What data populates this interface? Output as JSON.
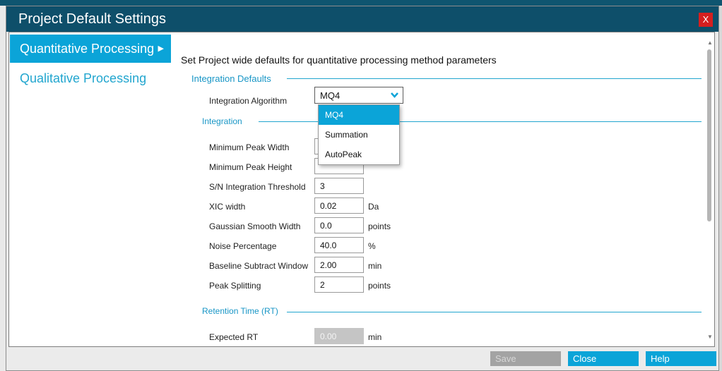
{
  "window": {
    "title": "Project Default Settings",
    "close_label": "X"
  },
  "nav": {
    "items": [
      {
        "label": "Quantitative Processing"
      },
      {
        "label": "Qualitative Processing"
      }
    ]
  },
  "main": {
    "heading": "Set Project wide defaults for quantitative processing method parameters",
    "integration_defaults": {
      "title": "Integration Defaults",
      "algorithm_label": "Integration Algorithm",
      "algorithm_value": "MQ4",
      "options": [
        "MQ4",
        "Summation",
        "AutoPeak"
      ]
    },
    "integration": {
      "title": "Integration",
      "fields": [
        {
          "label": "Minimum Peak Width",
          "value": "",
          "unit": ""
        },
        {
          "label": "Minimum Peak Height",
          "value": "",
          "unit": ""
        },
        {
          "label": "S/N Integration Threshold",
          "value": "3",
          "unit": ""
        },
        {
          "label": "XIC width",
          "value": "0.02",
          "unit": "Da"
        },
        {
          "label": "Gaussian Smooth Width",
          "value": "0.0",
          "unit": "points"
        },
        {
          "label": "Noise Percentage",
          "value": "40.0",
          "unit": "%"
        },
        {
          "label": "Baseline Subtract Window",
          "value": "2.00",
          "unit": "min"
        },
        {
          "label": "Peak Splitting",
          "value": "2",
          "unit": "points"
        }
      ]
    },
    "retention": {
      "title": "Retention Time (RT)",
      "expected_label": "Expected RT",
      "expected_value": "0.00",
      "expected_unit": "min"
    }
  },
  "footer": {
    "save": "Save",
    "close": "Close",
    "help": "Help"
  },
  "colors": {
    "titlebar": "#0e4f6a",
    "accent": "#0ba4d8",
    "close_button": "#d61f1f"
  }
}
